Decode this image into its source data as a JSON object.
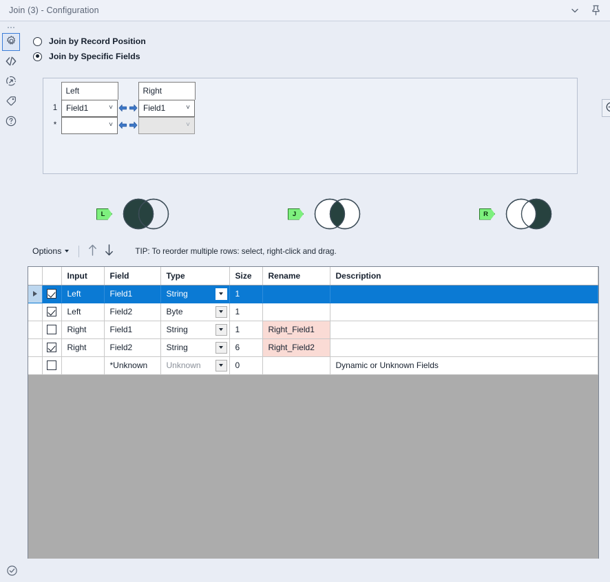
{
  "window": {
    "title": "Join (3) - Configuration",
    "collapse_icon": "chevron-down-icon",
    "pin_icon": "pin-icon"
  },
  "rail": {
    "items": [
      {
        "icon": "gear-icon",
        "name": "configuration",
        "active": true
      },
      {
        "icon": "code-brackets-icon",
        "name": "xml-view",
        "active": false
      },
      {
        "icon": "refresh-arrow-circle-icon",
        "name": "runtime",
        "active": false
      },
      {
        "icon": "tag-icon",
        "name": "annotation",
        "active": false
      },
      {
        "icon": "question-circle-icon",
        "name": "help",
        "active": false
      }
    ],
    "status_icon": "check-circle-icon"
  },
  "join_mode": {
    "options": [
      {
        "label": "Join by Record Position",
        "selected": false
      },
      {
        "label": "Join by Specific Fields",
        "selected": true
      }
    ]
  },
  "join_grid": {
    "headers": {
      "left": "Left",
      "right": "Right"
    },
    "rows": [
      {
        "num": "1",
        "left": "Field1",
        "right": "Field1",
        "right_disabled": false
      },
      {
        "num": "*",
        "left": "",
        "right": "",
        "right_disabled": true
      }
    ],
    "remove_button_icon": "circle-minus-icon"
  },
  "venn": [
    {
      "tag": "L",
      "name": "left-output",
      "fill": "left"
    },
    {
      "tag": "J",
      "name": "join-output",
      "fill": "center"
    },
    {
      "tag": "R",
      "name": "right-output",
      "fill": "right"
    }
  ],
  "toolbar": {
    "options_label": "Options",
    "move_up_icon": "arrow-up-icon",
    "move_down_icon": "arrow-down-icon",
    "tip": "TIP: To reorder multiple rows: select, right-click and drag."
  },
  "field_table": {
    "columns": [
      "",
      "",
      "Input",
      "Field",
      "Type",
      "Size",
      "Rename",
      "Description"
    ],
    "rows": [
      {
        "selected": true,
        "marker": true,
        "checked": true,
        "input": "Left",
        "field": "Field1",
        "type": "String",
        "type_dim": false,
        "size": "1",
        "size_dim": false,
        "rename": "",
        "rename_hl": false,
        "description": "",
        "desc_dim": false
      },
      {
        "selected": false,
        "marker": false,
        "checked": true,
        "input": "Left",
        "field": "Field2",
        "type": "Byte",
        "type_dim": false,
        "size": "1",
        "size_dim": true,
        "rename": "",
        "rename_hl": false,
        "description": "",
        "desc_dim": false
      },
      {
        "selected": false,
        "marker": false,
        "checked": false,
        "input": "Right",
        "field": "Field1",
        "type": "String",
        "type_dim": false,
        "size": "1",
        "size_dim": false,
        "rename": "Right_Field1",
        "rename_hl": true,
        "description": "",
        "desc_dim": false
      },
      {
        "selected": false,
        "marker": false,
        "checked": true,
        "input": "Right",
        "field": "Field2",
        "type": "String",
        "type_dim": false,
        "size": "6",
        "size_dim": false,
        "rename": "Right_Field2",
        "rename_hl": true,
        "description": "",
        "desc_dim": false
      },
      {
        "selected": false,
        "marker": false,
        "checked": false,
        "input": "",
        "field": "*Unknown",
        "type": "Unknown",
        "type_dim": true,
        "size": "0",
        "size_dim": true,
        "rename": "",
        "rename_hl": false,
        "description": "Dynamic or Unknown Fields",
        "desc_dim": true
      }
    ]
  },
  "colors": {
    "accent_blue": "#0b7ad4",
    "panel_bg": "#e9edf5",
    "venn_fill": "#27423f",
    "tag_green": "#7ef07e",
    "rename_highlight": "#fadbd5",
    "table_empty": "#acacac"
  }
}
